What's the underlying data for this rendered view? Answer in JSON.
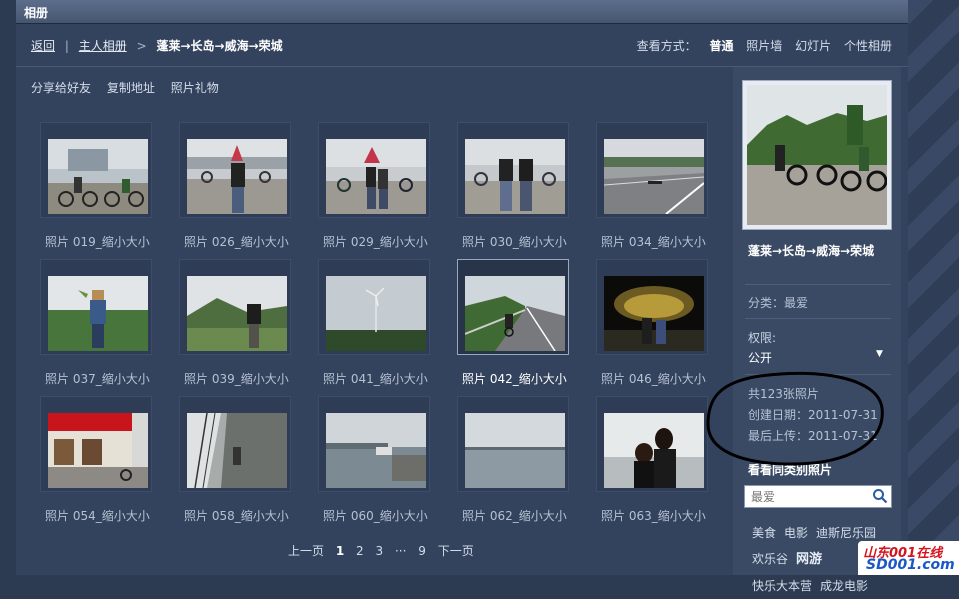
{
  "window": {
    "title": "相册"
  },
  "nav": {
    "back": "返回",
    "separator": "|",
    "owner_album": "主人相册",
    "chevron": ">",
    "album_name": "蓬莱→长岛→威海→荣城"
  },
  "view_modes": {
    "label": "查看方式：",
    "items": [
      "普通",
      "照片墙",
      "幻灯片",
      "个性相册"
    ],
    "selected": "普通"
  },
  "actions": [
    "分享给好友",
    "复制地址",
    "照片礼物"
  ],
  "photos": [
    {
      "caption": "照片 019_缩小大小",
      "icon": "photo-thumbnail",
      "selected": false
    },
    {
      "caption": "照片 026_缩小大小",
      "icon": "photo-thumbnail",
      "selected": false
    },
    {
      "caption": "照片 029_缩小大小",
      "icon": "photo-thumbnail",
      "selected": false
    },
    {
      "caption": "照片 030_缩小大小",
      "icon": "photo-thumbnail",
      "selected": false
    },
    {
      "caption": "照片 034_缩小大小",
      "icon": "photo-thumbnail",
      "selected": false
    },
    {
      "caption": "照片 037_缩小大小",
      "icon": "photo-thumbnail",
      "selected": false
    },
    {
      "caption": "照片 039_缩小大小",
      "icon": "photo-thumbnail",
      "selected": false
    },
    {
      "caption": "照片 041_缩小大小",
      "icon": "photo-thumbnail",
      "selected": false
    },
    {
      "caption": "照片 042_缩小大小",
      "icon": "photo-thumbnail",
      "selected": true
    },
    {
      "caption": "照片 046_缩小大小",
      "icon": "photo-thumbnail",
      "selected": false
    },
    {
      "caption": "照片 054_缩小大小",
      "icon": "photo-thumbnail",
      "selected": false
    },
    {
      "caption": "照片 058_缩小大小",
      "icon": "photo-thumbnail",
      "selected": false
    },
    {
      "caption": "照片 060_缩小大小",
      "icon": "photo-thumbnail",
      "selected": false
    },
    {
      "caption": "照片 062_缩小大小",
      "icon": "photo-thumbnail",
      "selected": false
    },
    {
      "caption": "照片 063_缩小大小",
      "icon": "photo-thumbnail",
      "selected": false
    }
  ],
  "pager": {
    "prev": "上一页",
    "pages": [
      "1",
      "2",
      "3"
    ],
    "ellipsis": "···",
    "last": "9",
    "next": "下一页",
    "current": "1"
  },
  "sidebar": {
    "album_title": "蓬莱→长岛→威海→荣城",
    "category": "分类：最爱",
    "permission_label": "权限:",
    "permission_value": "公开",
    "photo_count": "共123张照片",
    "created": "创建日期：2011-07-31",
    "last_upload": "最后上传：2011-07-31",
    "see_same_title": "看看同类别照片",
    "search_placeholder": "最爱",
    "tags": [
      "美食",
      "电影",
      "迪斯尼乐园",
      "欢乐谷",
      "网游",
      "快乐大本营",
      "成龙电影"
    ]
  },
  "watermark": {
    "line1": "山东001在线",
    "line2": "SD001.com"
  },
  "colors": {
    "background": "#2c3a52",
    "panel": "#33425d",
    "sidebar": "#3a4a65",
    "titlebar": "#5d6e8c"
  }
}
